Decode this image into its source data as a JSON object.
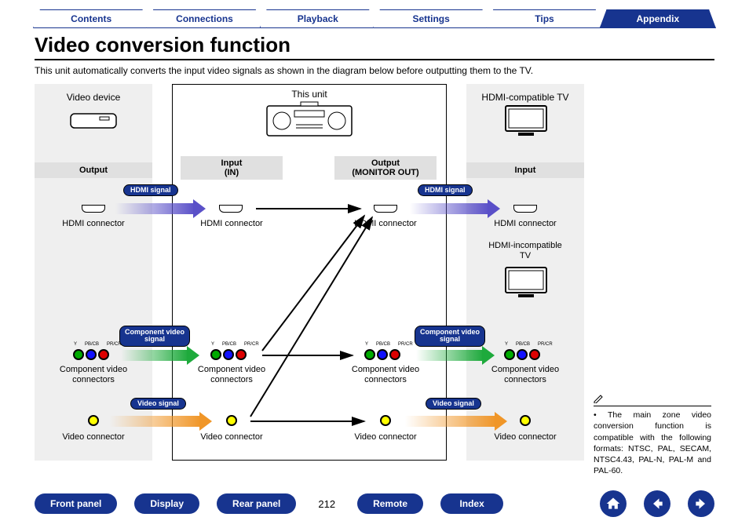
{
  "tabs": {
    "items": [
      "Contents",
      "Connections",
      "Playback",
      "Settings",
      "Tips",
      "Appendix"
    ],
    "active_index": 5
  },
  "title": "Video conversion function",
  "intro": "This unit automatically converts the input video signals as shown in the diagram below before outputting them to the TV.",
  "columns": {
    "device": {
      "title": "Video device",
      "header": "Output"
    },
    "unit": {
      "title": "This unit",
      "input_header": "Input\n(IN)",
      "output_header": "Output\n(MONITOR OUT)"
    },
    "tv": {
      "title": "HDMI-compatible TV",
      "title2": "HDMI-incompatible\nTV",
      "header": "Input"
    }
  },
  "signals": {
    "hdmi": "HDMI signal",
    "component": "Component video\nsignal",
    "video": "Video signal"
  },
  "labels": {
    "hdmi_connector": "HDMI connector",
    "component_connectors": "Component video\nconnectors",
    "video_connector": "Video connector",
    "rca_y": "Y",
    "rca_pb": "PB/CB",
    "rca_pr": "PR/CR"
  },
  "note": {
    "bullet": "•",
    "text": "The main zone video conversion function is compatible with the following formats: NTSC, PAL, SECAM, NTSC4.43, PAL-N, PAL-M and PAL-60."
  },
  "bottom": {
    "buttons": [
      "Front panel",
      "Display",
      "Rear panel"
    ],
    "page": "212",
    "buttons2": [
      "Remote",
      "Index"
    ],
    "nav": {
      "home": "home",
      "prev": "prev",
      "next": "next"
    }
  }
}
